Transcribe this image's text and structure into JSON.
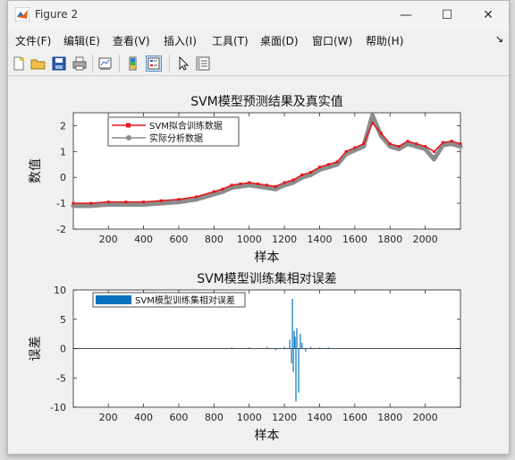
{
  "window": {
    "title": "Figure 2"
  },
  "window_controls": {
    "minimize": "—",
    "maximize": "☐",
    "close": "✕"
  },
  "menu": {
    "items": [
      "文件(F)",
      "编辑(E)",
      "查看(V)",
      "插入(I)",
      "工具(T)",
      "桌面(D)",
      "窗口(W)",
      "帮助(H)"
    ],
    "overflow": "↘"
  },
  "toolbar": {
    "icons": [
      "new-figure-icon",
      "open-file-icon",
      "save-icon",
      "print-icon",
      "link-plot-icon",
      "insert-colorbar-icon",
      "insert-legend-icon",
      "pointer-icon",
      "property-inspector-icon"
    ]
  },
  "colors": {
    "fit": "#e8151b",
    "actual": "#8c8c8c",
    "error": "#0a72bd"
  },
  "chart_data": [
    {
      "type": "line",
      "title": "SVM模型预测结果及真实值",
      "xlabel": "样本",
      "ylabel": "数值",
      "xlim": [
        1,
        2200
      ],
      "ylim": [
        -2,
        2.5
      ],
      "xticks": [
        200,
        400,
        600,
        800,
        1000,
        1200,
        1400,
        1600,
        1800,
        2000
      ],
      "yticks": [
        -2,
        -1,
        0,
        1,
        2
      ],
      "legend_position": "top-left",
      "series": [
        {
          "name": "SVM拟合训练数据",
          "marker": "square",
          "x": [
            1,
            100,
            200,
            300,
            400,
            500,
            600,
            700,
            800,
            850,
            900,
            950,
            1000,
            1050,
            1100,
            1150,
            1200,
            1250,
            1300,
            1350,
            1400,
            1450,
            1500,
            1550,
            1600,
            1650,
            1700,
            1750,
            1800,
            1850,
            1900,
            1950,
            2000,
            2050,
            2100,
            2150,
            2200
          ],
          "values": [
            -1.0,
            -1.0,
            -0.95,
            -0.95,
            -0.95,
            -0.9,
            -0.85,
            -0.75,
            -0.55,
            -0.45,
            -0.3,
            -0.25,
            -0.2,
            -0.25,
            -0.3,
            -0.35,
            -0.2,
            -0.1,
            0.1,
            0.2,
            0.4,
            0.5,
            0.6,
            1.0,
            1.15,
            1.3,
            2.1,
            1.7,
            1.3,
            1.2,
            1.4,
            1.3,
            1.2,
            1.0,
            1.35,
            1.4,
            1.3
          ]
        },
        {
          "name": "实际分析数据",
          "marker": "circle",
          "x": [
            1,
            100,
            200,
            300,
            400,
            500,
            600,
            700,
            800,
            850,
            900,
            950,
            1000,
            1050,
            1100,
            1150,
            1200,
            1250,
            1300,
            1350,
            1400,
            1450,
            1500,
            1550,
            1600,
            1650,
            1700,
            1750,
            1800,
            1850,
            1900,
            1950,
            2000,
            2050,
            2100,
            2150,
            2200
          ],
          "values": [
            -1.1,
            -1.1,
            -1.05,
            -1.05,
            -1.05,
            -1.0,
            -0.95,
            -0.85,
            -0.65,
            -0.55,
            -0.4,
            -0.35,
            -0.3,
            -0.35,
            -0.4,
            -0.45,
            -0.3,
            -0.2,
            0.0,
            0.1,
            0.3,
            0.4,
            0.5,
            0.9,
            1.05,
            1.2,
            2.4,
            1.6,
            1.2,
            1.1,
            1.3,
            1.2,
            1.1,
            0.7,
            1.25,
            1.3,
            1.2
          ]
        }
      ]
    },
    {
      "type": "bar",
      "title": "SVM模型训练集相对误差",
      "xlabel": "样本",
      "ylabel": "误差",
      "xlim": [
        1,
        2200
      ],
      "ylim": [
        -10,
        10
      ],
      "xticks": [
        200,
        400,
        600,
        800,
        1000,
        1200,
        1400,
        1600,
        1800,
        2000
      ],
      "yticks": [
        -10,
        -5,
        0,
        5,
        10
      ],
      "legend_position": "top-left",
      "series": [
        {
          "name": "SVM模型训练集相对误差",
          "x": [
            900,
            1000,
            1100,
            1150,
            1200,
            1230,
            1240,
            1245,
            1250,
            1255,
            1260,
            1265,
            1270,
            1280,
            1290,
            1300,
            1320,
            1350,
            1400,
            1450,
            1500
          ],
          "values": [
            0.2,
            0.2,
            0.3,
            -0.3,
            0.3,
            1.5,
            -2.5,
            8.5,
            -4.0,
            3.0,
            2.0,
            -9.0,
            3.5,
            -7.5,
            2.5,
            1.0,
            -0.5,
            0.3,
            0.2,
            0.2,
            0.1
          ]
        }
      ]
    }
  ]
}
